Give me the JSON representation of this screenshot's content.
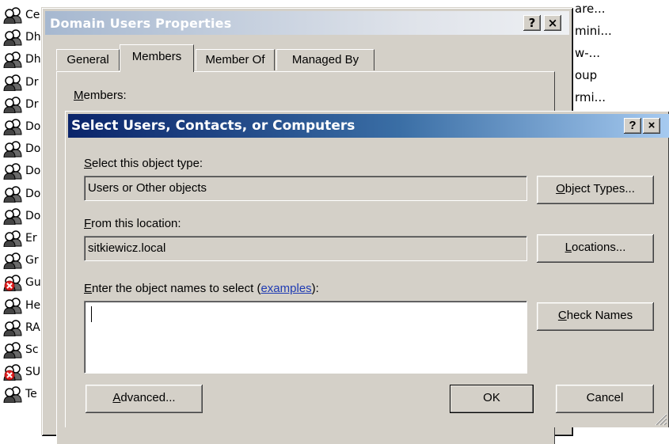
{
  "background_list": {
    "rows": [
      {
        "text": "Ce",
        "icon": "group-icon"
      },
      {
        "text": "Dh",
        "icon": "group-icon"
      },
      {
        "text": "Dh",
        "icon": "group-icon"
      },
      {
        "text": "Dr",
        "icon": "group-icon"
      },
      {
        "text": "Dr",
        "icon": "group-icon"
      },
      {
        "text": "Do",
        "icon": "group-icon"
      },
      {
        "text": "Do",
        "icon": "group-icon"
      },
      {
        "text": "Do",
        "icon": "group-icon"
      },
      {
        "text": "Do",
        "icon": "group-icon"
      },
      {
        "text": "Do",
        "icon": "group-icon"
      },
      {
        "text": "Er",
        "icon": "group-icon"
      },
      {
        "text": "Gr",
        "icon": "group-icon"
      },
      {
        "text": "Gu",
        "icon": "disabled-group-icon"
      },
      {
        "text": "He",
        "icon": "group-icon"
      },
      {
        "text": "RA",
        "icon": "group-icon"
      },
      {
        "text": "Sc",
        "icon": "group-icon"
      },
      {
        "text": "SU",
        "icon": "disabled-group-icon"
      },
      {
        "text": "Te",
        "icon": "group-icon"
      }
    ],
    "right_items": [
      "are...",
      "mini...",
      "w-...",
      "oup",
      "rmi..."
    ]
  },
  "properties_window": {
    "title": "Domain Users Properties",
    "help_btn": "?",
    "close_btn": "×",
    "tabs": [
      "General",
      "Members",
      "Member Of",
      "Managed By"
    ],
    "active_tab": "Members",
    "members_label": "Members:"
  },
  "select_dialog": {
    "title": "Select Users, Contacts, or Computers",
    "help_btn": "?",
    "close_btn": "×",
    "object_type_label": "Select this object type:",
    "object_type_value": "Users or Other objects",
    "object_types_button": "Object Types...",
    "location_label": "From this location:",
    "location_value": "sitkiewicz.local",
    "locations_button": "Locations...",
    "names_label_prefix": "Enter the object names to select (",
    "names_label_link": "examples",
    "names_label_suffix": "):",
    "names_value": "",
    "check_names_button": "Check Names",
    "advanced_button": "Advanced...",
    "ok_button": "OK",
    "cancel_button": "Cancel"
  }
}
